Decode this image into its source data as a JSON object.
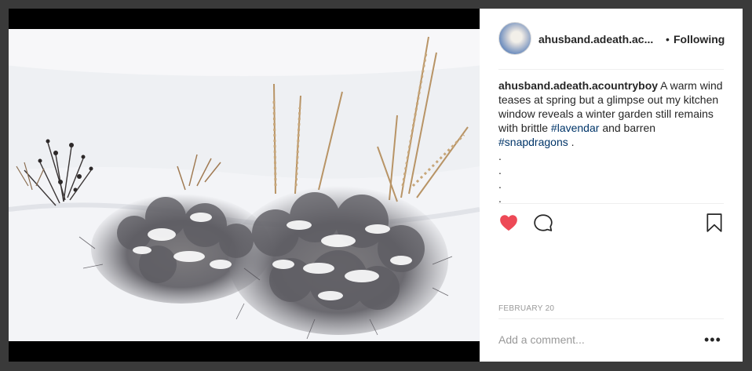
{
  "post": {
    "username_short": "ahusband.adeath.ac...",
    "follow_dot": "•",
    "follow_label": "Following",
    "caption": {
      "username": "ahusband.adeath.acountryboy",
      "text_before": "A warm wind teases at spring but a glimpse out my kitchen window reveals a winter garden still remains with brittle",
      "hashtag1": "#lavendar",
      "text_middle": "and barren",
      "hashtag2": "#snapdragons",
      "text_after": ".",
      "dots": [
        ".",
        ".",
        ".",
        "."
      ]
    },
    "date": "FEBRUARY 20",
    "comment_placeholder": "Add a comment...",
    "more_label": "•••"
  },
  "icons": {
    "avatar": "avatar",
    "like": "heart-icon",
    "comment": "comment-icon",
    "save": "bookmark-icon",
    "more": "more-options-icon"
  },
  "colors": {
    "heart": "#ed4956",
    "hashtag": "#003569",
    "text": "#262626",
    "muted": "#999999"
  }
}
